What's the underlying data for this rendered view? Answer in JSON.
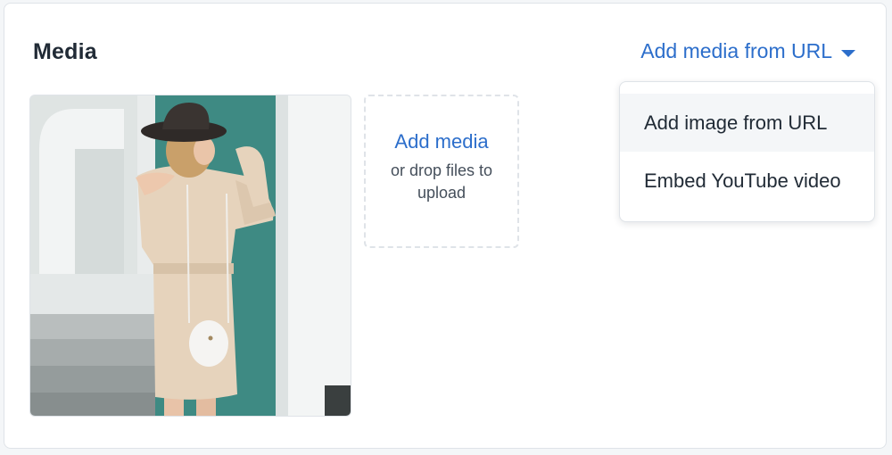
{
  "section": {
    "title": "Media",
    "add_from_url_label": "Add media from URL"
  },
  "dropzone": {
    "link_label": "Add media",
    "hint": "or drop files to upload"
  },
  "url_menu": {
    "items": [
      {
        "label": "Add image from URL",
        "state": "hover"
      },
      {
        "label": "Embed YouTube video"
      }
    ]
  },
  "colors": {
    "accent": "#2c6ecb",
    "heading": "#212b36",
    "border": "#dfe3e8"
  },
  "icons": [
    "chevron-down-icon"
  ]
}
